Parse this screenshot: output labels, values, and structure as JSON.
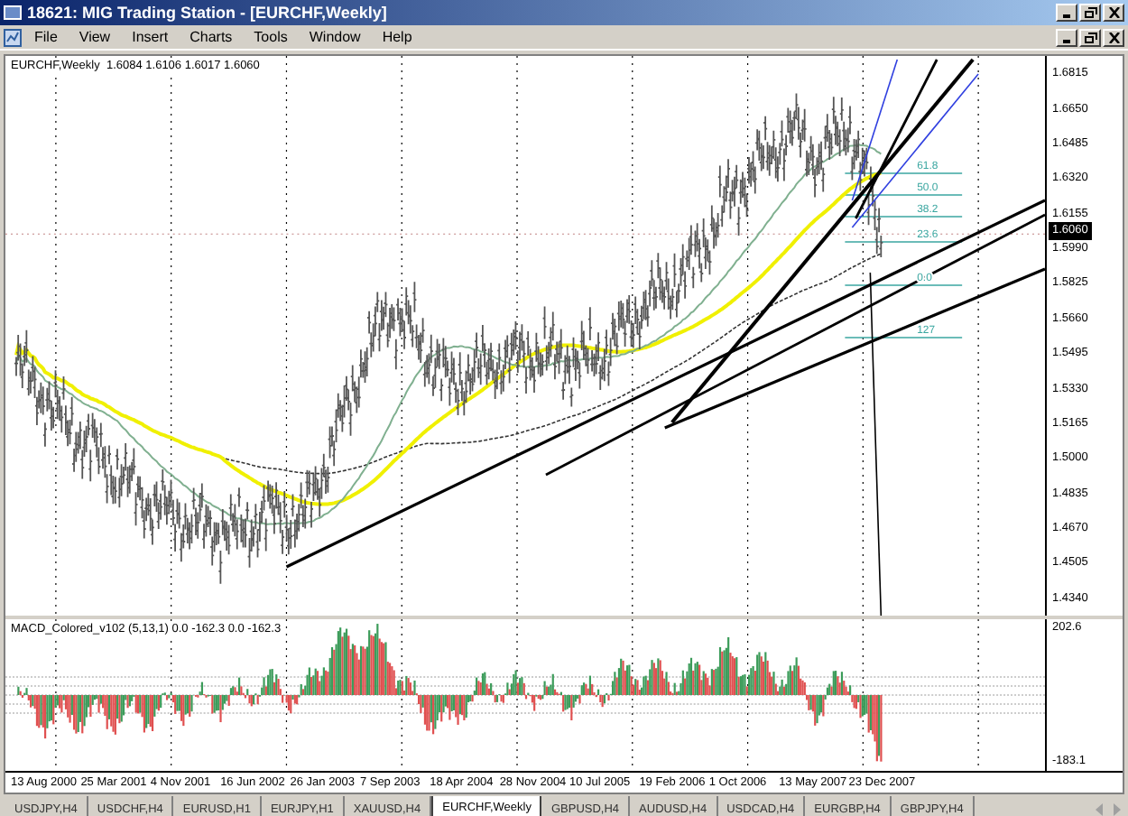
{
  "window": {
    "title": "18621: MIG Trading Station - [EURCHF,Weekly]"
  },
  "menu": [
    "File",
    "View",
    "Insert",
    "Charts",
    "Tools",
    "Window",
    "Help"
  ],
  "chart": {
    "header": "EURCHF,Weekly  1.6084 1.6106 1.6017 1.6060",
    "price_axis": [
      {
        "label": "1.6815",
        "kind": "tick"
      },
      {
        "label": "1.6650",
        "kind": "tick"
      },
      {
        "label": "1.6485",
        "kind": "tick"
      },
      {
        "label": "1.6320",
        "kind": "tick"
      },
      {
        "label": "1.6155",
        "kind": "tick"
      },
      {
        "label": "1.6060",
        "kind": "current"
      },
      {
        "label": "1.5990",
        "kind": "tick"
      },
      {
        "label": "1.5825",
        "kind": "tick"
      },
      {
        "label": "1.5660",
        "kind": "tick"
      },
      {
        "label": "1.5495",
        "kind": "tick"
      },
      {
        "label": "1.5330",
        "kind": "tick"
      },
      {
        "label": "1.5165",
        "kind": "tick"
      },
      {
        "label": "1.5000",
        "kind": "tick"
      },
      {
        "label": "1.4835",
        "kind": "tick"
      },
      {
        "label": "1.4670",
        "kind": "tick"
      },
      {
        "label": "1.4505",
        "kind": "tick"
      },
      {
        "label": "1.4340",
        "kind": "tick"
      }
    ],
    "fib_levels": [
      "61.8",
      "50.0",
      "38.2",
      "23.6",
      "0.0",
      "127"
    ]
  },
  "indicator": {
    "header": "MACD_Colored_v102 (5,13,1) 0.0 -162.3 0.0 -162.3",
    "axis": [
      "202.6",
      "-183.1"
    ]
  },
  "date_axis": [
    "13 Aug 2000",
    "25 Mar 2001",
    "4 Nov 2001",
    "16 Jun 2002",
    "26 Jan 2003",
    "7 Sep 2003",
    "18 Apr 2004",
    "28 Nov 2004",
    "10 Jul 2005",
    "19 Feb 2006",
    "1 Oct 2006",
    "13 May 2007",
    "23 Dec 2007"
  ],
  "tabs": [
    {
      "label": "USDJPY,H4",
      "selected": false
    },
    {
      "label": "USDCHF,H4",
      "selected": false
    },
    {
      "label": "EURUSD,H1",
      "selected": false
    },
    {
      "label": "EURJPY,H1",
      "selected": false
    },
    {
      "label": "XAUUSD,H4",
      "selected": false
    },
    {
      "label": "EURCHF,Weekly",
      "selected": true
    },
    {
      "label": "GBPUSD,H4",
      "selected": false
    },
    {
      "label": "AUDUSD,H4",
      "selected": false
    },
    {
      "label": "USDCAD,H4",
      "selected": false
    },
    {
      "label": "EURGBP,H4",
      "selected": false
    },
    {
      "label": "GBPJPY,H4",
      "selected": false
    }
  ]
}
